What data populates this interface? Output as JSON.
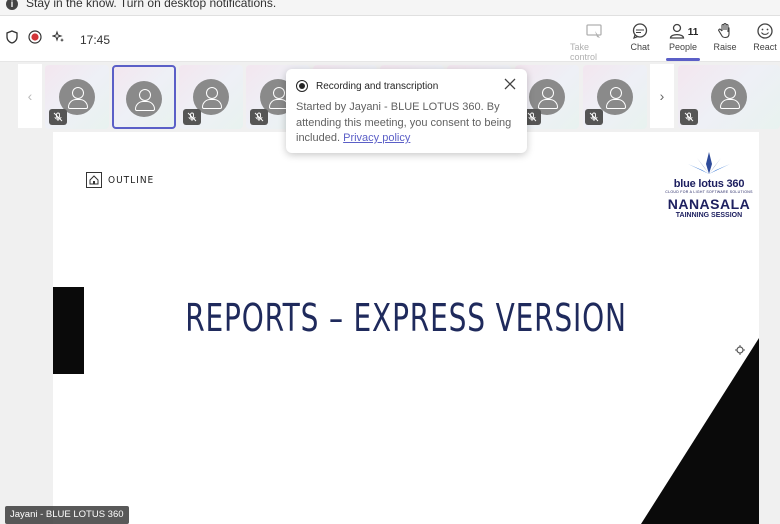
{
  "banner": {
    "message": "Stay in the know. Turn on desktop notifications.",
    "info_icon": "info-icon"
  },
  "topbar": {
    "time": "17:45",
    "take_control_label": "Take control",
    "chat_label": "Chat",
    "people_label": "People",
    "people_count": "11",
    "raise_label": "Raise",
    "react_label": "React"
  },
  "popup": {
    "title": "Recording and transcription",
    "body": "Started by Jayani - BLUE LOTUS 360. By attending this meeting, you consent to being included.",
    "link": "Privacy policy"
  },
  "slide": {
    "outline_label": "OUTLINE",
    "title": "REPORTS – EXPRESS VERSION",
    "logo_brand": "blue lotus 360",
    "logo_tagline": "CLOUD FOR A LIGHT SOFTWARE SOLUTIONS",
    "logo_nanasala": "NANASALA",
    "logo_session": "TAINNING SESSION"
  },
  "presenter_badge": "Jayani - BLUE LOTUS 360",
  "colors": {
    "accent": "#5b5fc7",
    "record_red": "#d13438",
    "slide_title": "#1f2a5c"
  }
}
